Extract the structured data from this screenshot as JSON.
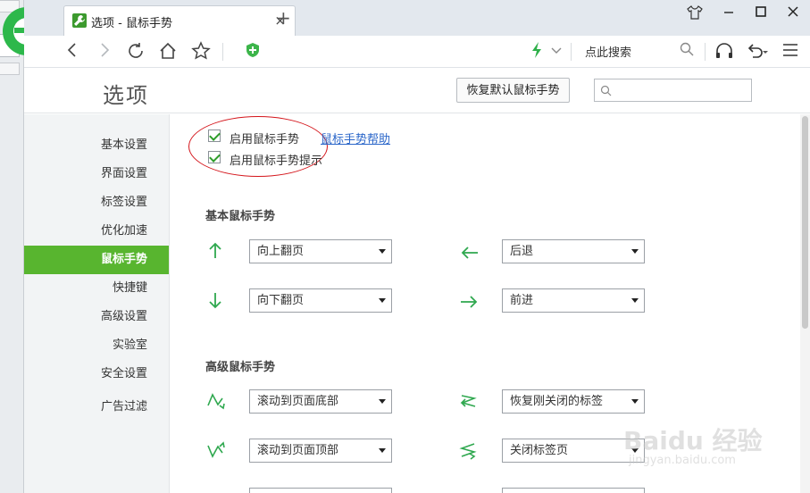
{
  "tab": {
    "title": "选项 - 鼠标手势",
    "close": "×",
    "new_tab": "+"
  },
  "toolbar": {
    "search_label": "点此搜索"
  },
  "options": {
    "page_title": "选项",
    "restore_button": "恢复默认鼠标手势",
    "search_placeholder": ""
  },
  "sidebar": {
    "items": [
      {
        "label": "基本设置"
      },
      {
        "label": "界面设置"
      },
      {
        "label": "标签设置"
      },
      {
        "label": "优化加速"
      },
      {
        "label": "鼠标手势",
        "active": true
      },
      {
        "label": "快捷键"
      },
      {
        "label": "高级设置"
      },
      {
        "label": "实验室"
      },
      {
        "label": "安全设置"
      },
      {
        "label": "广告过滤"
      }
    ]
  },
  "gesture": {
    "enable_label": "启用鼠标手势",
    "enable_checked": true,
    "hint_label": "启用鼠标手势提示",
    "hint_checked": true,
    "help_link": "鼠标手势帮助",
    "basic_title": "基本鼠标手势",
    "basic": [
      {
        "icon": "arrow-up-icon",
        "value": "向上翻页"
      },
      {
        "icon": "arrow-left-icon",
        "value": "后退"
      },
      {
        "icon": "arrow-down-icon",
        "value": "向下翻页"
      },
      {
        "icon": "arrow-right-icon",
        "value": "前进"
      }
    ],
    "advanced_title": "高级鼠标手势",
    "advanced": [
      {
        "icon": "gesture-down-up-down-icon",
        "value": "滚动到页面底部"
      },
      {
        "icon": "gesture-right-left-right-icon",
        "value": "恢复刚关闭的标签"
      },
      {
        "icon": "gesture-up-down-up-icon",
        "value": "滚动到页面顶部"
      },
      {
        "icon": "gesture-left-right-left-icon",
        "value": "关闭标签页"
      }
    ]
  },
  "watermark": {
    "line1": "Baidu 经验",
    "line2": "jingyan.baidu.com"
  },
  "colors": {
    "accent": "#58b52f",
    "arrow": "#2fa84f",
    "annotation": "#d4151b",
    "link": "#2a66c9"
  }
}
